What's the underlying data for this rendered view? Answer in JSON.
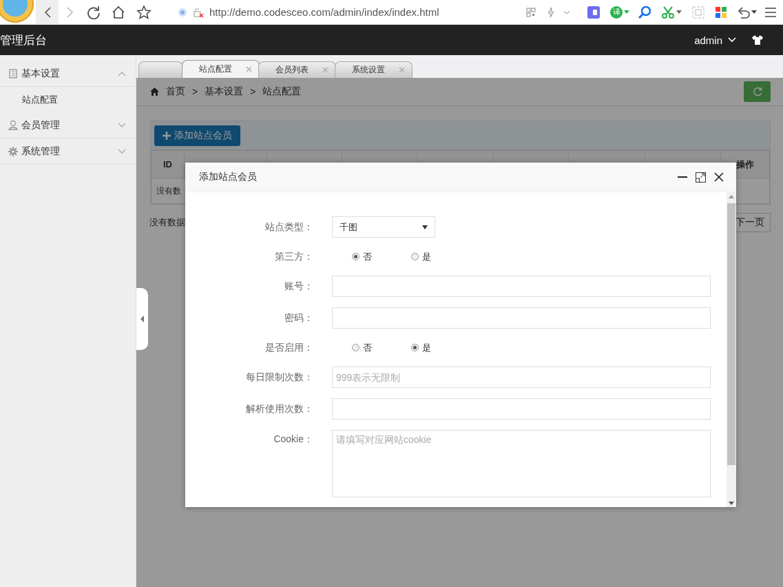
{
  "browser": {
    "url": "http://demo.codesceo.com/admin/index/index.html",
    "translate_badge": "译"
  },
  "header": {
    "title": "管理后台",
    "user": "admin"
  },
  "sidebar": {
    "items": [
      {
        "label": "基本设置",
        "expanded": true,
        "children": [
          {
            "label": "站点配置"
          }
        ]
      },
      {
        "label": "会员管理",
        "expanded": false
      },
      {
        "label": "系统管理",
        "expanded": false
      }
    ]
  },
  "tabs": [
    {
      "kind": "home",
      "selected": false
    },
    {
      "kind": "page",
      "label": "站点配置",
      "selected": true
    },
    {
      "kind": "page",
      "label": "会员列表",
      "selected": false
    },
    {
      "kind": "page",
      "label": "系统设置",
      "selected": false
    }
  ],
  "breadcrumb": {
    "separator": ">",
    "items": [
      "首页",
      "基本设置",
      "站点配置"
    ]
  },
  "add_button": "添加站点会员",
  "table": {
    "columns": [
      "ID",
      "操作"
    ],
    "empty_text": "没有数"
  },
  "pagination": {
    "info": "没有数据",
    "next": "下一页"
  },
  "dialog": {
    "title": "添加站点会员",
    "fields": [
      {
        "kind": "select",
        "label": "站点类型：",
        "value": "千图"
      },
      {
        "kind": "radio",
        "label": "第三方：",
        "options": [
          {
            "label": "否",
            "selected": true
          },
          {
            "label": "是",
            "selected": false
          }
        ]
      },
      {
        "kind": "text",
        "label": "账号："
      },
      {
        "kind": "text",
        "label": "密码："
      },
      {
        "kind": "radio",
        "label": "是否启用：",
        "options": [
          {
            "label": "否",
            "selected": false
          },
          {
            "label": "是",
            "selected": true
          }
        ]
      },
      {
        "kind": "text",
        "label": "每日限制次数：",
        "placeholder": "999表示无限制"
      },
      {
        "kind": "text",
        "label": "解析使用次数："
      },
      {
        "kind": "textarea",
        "label": "Cookie：",
        "placeholder": "请填写对应网站cookie"
      }
    ]
  }
}
